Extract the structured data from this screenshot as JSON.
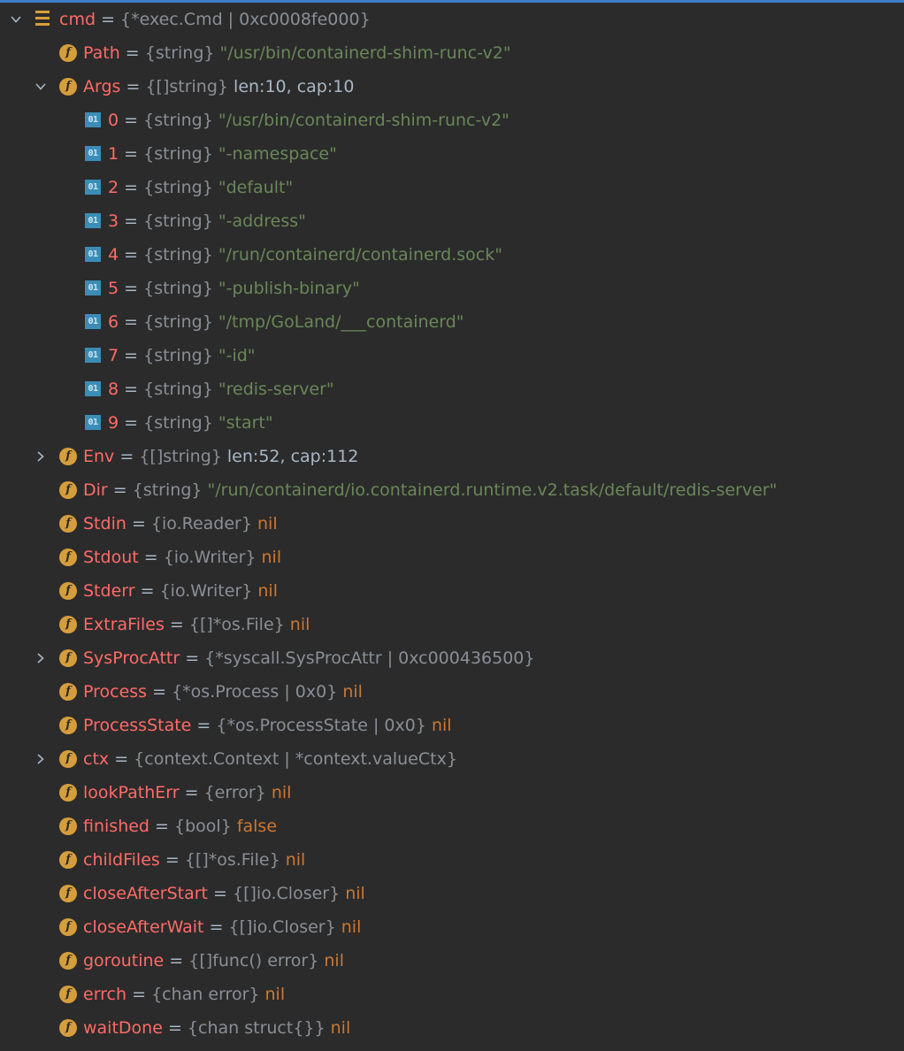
{
  "equals": "=",
  "rows": [
    {
      "depth": 0,
      "expand": "expanded",
      "icon": "struct-icon",
      "name": "cmd",
      "type": "{*exec.Cmd | 0xc0008fe000}",
      "value": "",
      "value_kind": "plain"
    },
    {
      "depth": 1,
      "expand": "none",
      "icon": "field-icon",
      "name": "Path",
      "type": "{string}",
      "value": "\"/usr/bin/containerd-shim-runc-v2\"",
      "value_kind": "str"
    },
    {
      "depth": 1,
      "expand": "expanded",
      "icon": "field-icon",
      "name": "Args",
      "type": "{[]string}",
      "value": "len:10, cap:10",
      "value_kind": "plain"
    },
    {
      "depth": 2,
      "expand": "none",
      "icon": "array-element-icon",
      "name": "0",
      "type": "{string}",
      "value": "\"/usr/bin/containerd-shim-runc-v2\"",
      "value_kind": "str"
    },
    {
      "depth": 2,
      "expand": "none",
      "icon": "array-element-icon",
      "name": "1",
      "type": "{string}",
      "value": "\"-namespace\"",
      "value_kind": "str"
    },
    {
      "depth": 2,
      "expand": "none",
      "icon": "array-element-icon",
      "name": "2",
      "type": "{string}",
      "value": "\"default\"",
      "value_kind": "str"
    },
    {
      "depth": 2,
      "expand": "none",
      "icon": "array-element-icon",
      "name": "3",
      "type": "{string}",
      "value": "\"-address\"",
      "value_kind": "str"
    },
    {
      "depth": 2,
      "expand": "none",
      "icon": "array-element-icon",
      "name": "4",
      "type": "{string}",
      "value": "\"/run/containerd/containerd.sock\"",
      "value_kind": "str"
    },
    {
      "depth": 2,
      "expand": "none",
      "icon": "array-element-icon",
      "name": "5",
      "type": "{string}",
      "value": "\"-publish-binary\"",
      "value_kind": "str"
    },
    {
      "depth": 2,
      "expand": "none",
      "icon": "array-element-icon",
      "name": "6",
      "type": "{string}",
      "value": "\"/tmp/GoLand/___containerd\"",
      "value_kind": "str"
    },
    {
      "depth": 2,
      "expand": "none",
      "icon": "array-element-icon",
      "name": "7",
      "type": "{string}",
      "value": "\"-id\"",
      "value_kind": "str"
    },
    {
      "depth": 2,
      "expand": "none",
      "icon": "array-element-icon",
      "name": "8",
      "type": "{string}",
      "value": "\"redis-server\"",
      "value_kind": "str"
    },
    {
      "depth": 2,
      "expand": "none",
      "icon": "array-element-icon",
      "name": "9",
      "type": "{string}",
      "value": "\"start\"",
      "value_kind": "str"
    },
    {
      "depth": 1,
      "expand": "collapsed",
      "icon": "field-icon",
      "name": "Env",
      "type": "{[]string}",
      "value": "len:52, cap:112",
      "value_kind": "plain"
    },
    {
      "depth": 1,
      "expand": "none",
      "icon": "field-icon",
      "name": "Dir",
      "type": "{string}",
      "value": "\"/run/containerd/io.containerd.runtime.v2.task/default/redis-server\"",
      "value_kind": "str"
    },
    {
      "depth": 1,
      "expand": "none",
      "icon": "field-icon",
      "name": "Stdin",
      "type": "{io.Reader}",
      "value": "nil",
      "value_kind": "kw"
    },
    {
      "depth": 1,
      "expand": "none",
      "icon": "field-icon",
      "name": "Stdout",
      "type": "{io.Writer}",
      "value": "nil",
      "value_kind": "kw"
    },
    {
      "depth": 1,
      "expand": "none",
      "icon": "field-icon",
      "name": "Stderr",
      "type": "{io.Writer}",
      "value": "nil",
      "value_kind": "kw"
    },
    {
      "depth": 1,
      "expand": "none",
      "icon": "field-icon",
      "name": "ExtraFiles",
      "type": "{[]*os.File}",
      "value": "nil",
      "value_kind": "kw"
    },
    {
      "depth": 1,
      "expand": "collapsed",
      "icon": "field-icon",
      "name": "SysProcAttr",
      "type": "{*syscall.SysProcAttr | 0xc000436500}",
      "value": "",
      "value_kind": "plain"
    },
    {
      "depth": 1,
      "expand": "none",
      "icon": "field-icon",
      "name": "Process",
      "type": "{*os.Process | 0x0}",
      "value": "nil",
      "value_kind": "kw"
    },
    {
      "depth": 1,
      "expand": "none",
      "icon": "field-icon",
      "name": "ProcessState",
      "type": "{*os.ProcessState | 0x0}",
      "value": "nil",
      "value_kind": "kw"
    },
    {
      "depth": 1,
      "expand": "collapsed",
      "icon": "field-icon",
      "name": "ctx",
      "type": "{context.Context | *context.valueCtx}",
      "value": "",
      "value_kind": "plain"
    },
    {
      "depth": 1,
      "expand": "none",
      "icon": "field-icon",
      "name": "lookPathErr",
      "type": "{error}",
      "value": "nil",
      "value_kind": "kw"
    },
    {
      "depth": 1,
      "expand": "none",
      "icon": "field-icon",
      "name": "finished",
      "type": "{bool}",
      "value": "false",
      "value_kind": "kw"
    },
    {
      "depth": 1,
      "expand": "none",
      "icon": "field-icon",
      "name": "childFiles",
      "type": "{[]*os.File}",
      "value": "nil",
      "value_kind": "kw"
    },
    {
      "depth": 1,
      "expand": "none",
      "icon": "field-icon",
      "name": "closeAfterStart",
      "type": "{[]io.Closer}",
      "value": "nil",
      "value_kind": "kw"
    },
    {
      "depth": 1,
      "expand": "none",
      "icon": "field-icon",
      "name": "closeAfterWait",
      "type": "{[]io.Closer}",
      "value": "nil",
      "value_kind": "kw"
    },
    {
      "depth": 1,
      "expand": "none",
      "icon": "field-icon",
      "name": "goroutine",
      "type": "{[]func() error}",
      "value": "nil",
      "value_kind": "kw"
    },
    {
      "depth": 1,
      "expand": "none",
      "icon": "field-icon",
      "name": "errch",
      "type": "{chan error}",
      "value": "nil",
      "value_kind": "kw"
    },
    {
      "depth": 1,
      "expand": "none",
      "icon": "field-icon",
      "name": "waitDone",
      "type": "{chan struct{}}",
      "value": "nil",
      "value_kind": "kw"
    }
  ],
  "icon_glyphs": {
    "field": "f",
    "array": "01"
  },
  "colors": {
    "background": "#2b2b2b",
    "name": "#ff6b68",
    "type": "#8a8f96",
    "string": "#6a8759",
    "keyword": "#cc7832",
    "field_icon": "#d69e3b",
    "array_icon": "#3b8db8",
    "selection_line": "#3c7ec8"
  }
}
